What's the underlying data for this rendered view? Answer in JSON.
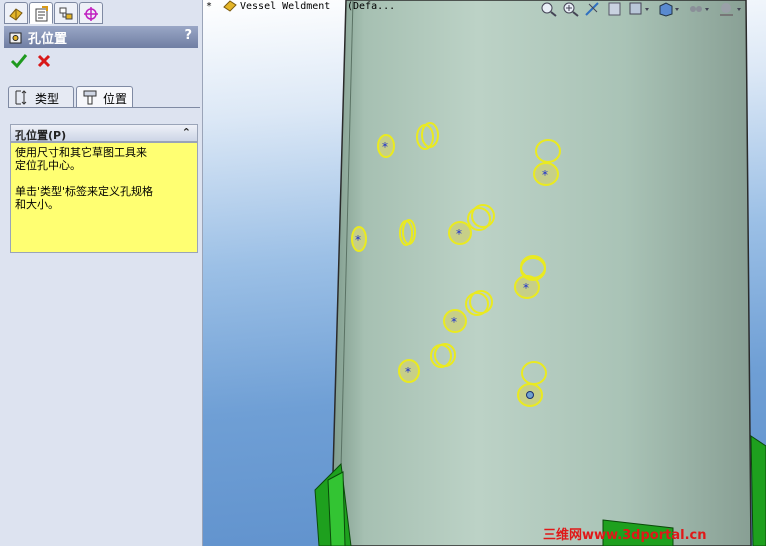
{
  "panel_tabs": [
    {
      "icon": "feature-manager-icon",
      "active": false
    },
    {
      "icon": "property-manager-icon",
      "active": true
    },
    {
      "icon": "configuration-manager-icon",
      "active": false
    },
    {
      "icon": "dimxpert-icon",
      "active": false
    }
  ],
  "property_manager": {
    "title": "孔位置",
    "help": "?",
    "tabs": [
      {
        "label": "类型",
        "icon": "hole-type-icon"
      },
      {
        "label": "位置",
        "icon": "hole-position-icon"
      }
    ],
    "group_title": "孔位置(P)",
    "message_lines": [
      "使用尺寸和其它草图工具来",
      "定位孔中心。",
      "单击'类型'标签来定义孔规格",
      "和大小。"
    ]
  },
  "tree": {
    "expand": "*",
    "name": "Vessel Weldment",
    "config": "(Defa..."
  },
  "view_toolbar": [
    "zoom-to-fit-icon",
    "zoom-area-icon",
    "previous-view-icon",
    "section-view-icon",
    "view-orientation-icon",
    "display-style-icon",
    "hide-show-icon",
    "apply-scene-icon"
  ],
  "watermark": "三维网www.3dportal.cn",
  "colors": {
    "accept": "#1f9a1f",
    "cancel": "#d81818",
    "message_bg": "#ffff72",
    "highlight": "#f2f21a",
    "vessel": "#a8c4b4",
    "support": "#1ea01e"
  }
}
